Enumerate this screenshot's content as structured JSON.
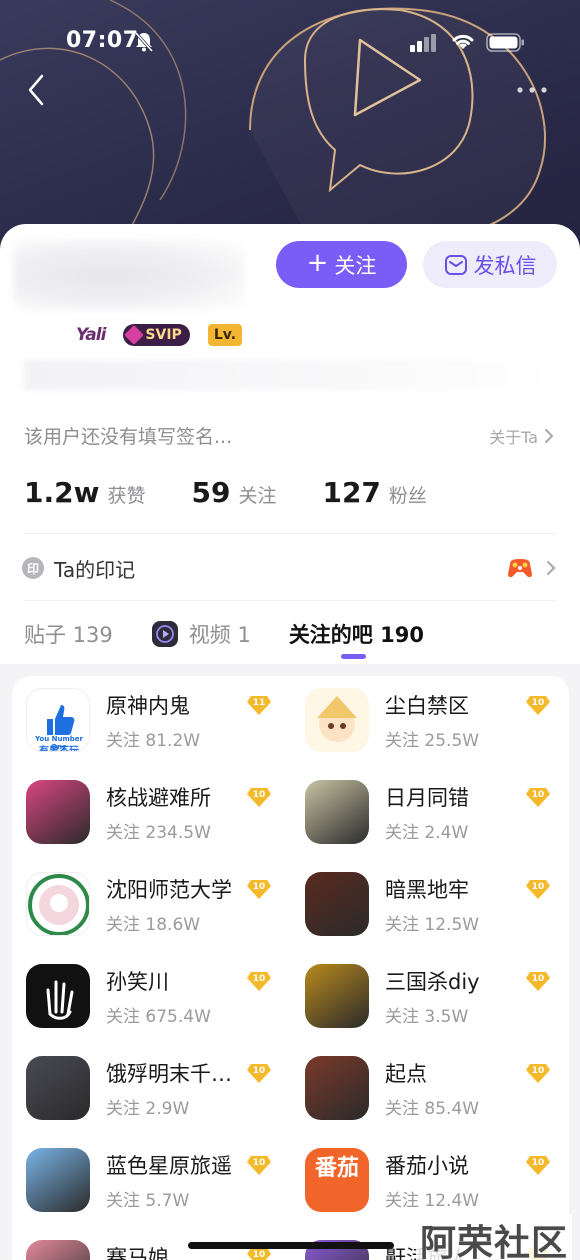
{
  "status_bar": {
    "time": "07:07"
  },
  "profile": {
    "follow_button": "关注",
    "message_button": "发私信",
    "badge_name": "Yali",
    "badge_svip": "SVIP",
    "badge_lv": "Lv.",
    "signature": "该用户还没有填写签名...",
    "about": "关于Ta",
    "stats": [
      {
        "value": "1.2w",
        "label": "获赞"
      },
      {
        "value": "59",
        "label": "关注"
      },
      {
        "value": "127",
        "label": "粉丝"
      }
    ],
    "mark_icon": "印",
    "mark_label": "Ta的印记"
  },
  "tabs": [
    {
      "label": "贴子 139"
    },
    {
      "label": "视频 1"
    },
    {
      "label": "关注的吧 190"
    }
  ],
  "bars": [
    {
      "name": "原神内鬼",
      "follow": "关注 81.2W",
      "level": "11",
      "color": "#1e6fe0"
    },
    {
      "name": "尘白禁区",
      "follow": "关注 25.5W",
      "level": "10",
      "color": "#f2c76a"
    },
    {
      "name": "核战避难所",
      "follow": "关注 234.5W",
      "level": "10",
      "color": "#d94680"
    },
    {
      "name": "日月同错",
      "follow": "关注 2.4W",
      "level": "10",
      "color": "#c9c4a4"
    },
    {
      "name": "沈阳师范大学",
      "follow": "关注 18.6W",
      "level": "10",
      "color": "#2f8a4a"
    },
    {
      "name": "暗黑地牢",
      "follow": "关注 12.5W",
      "level": "10",
      "color": "#5a2a1e"
    },
    {
      "name": "孙笑川",
      "follow": "关注 675.4W",
      "level": "10",
      "color": "#111111"
    },
    {
      "name": "三国杀diy",
      "follow": "关注 3.5W",
      "level": "10",
      "color": "#b88a1e"
    },
    {
      "name": "饿殍明末千…",
      "follow": "关注 2.9W",
      "level": "10",
      "color": "#4a4a55"
    },
    {
      "name": "起点",
      "follow": "关注 85.4W",
      "level": "10",
      "color": "#7a3a2a"
    },
    {
      "name": "蓝色星原旅遥",
      "follow": "关注 5.7W",
      "level": "10",
      "color": "#7ab4e6"
    },
    {
      "name": "番茄小说",
      "follow": "关注 12.4W",
      "level": "10",
      "color": "#f2652a"
    },
    {
      "name": "赛马娘",
      "follow": "",
      "level": "10",
      "color": "#e48a9a"
    },
    {
      "name": "鼾活旅人",
      "follow": "",
      "level": "10",
      "color": "#8a5ad6"
    }
  ],
  "avatar_texts": {
    "yuanshen": "有男不玩",
    "yuanshen_sub": "You Number One",
    "fanqie": "番茄"
  },
  "watermark": "阿荣社区"
}
